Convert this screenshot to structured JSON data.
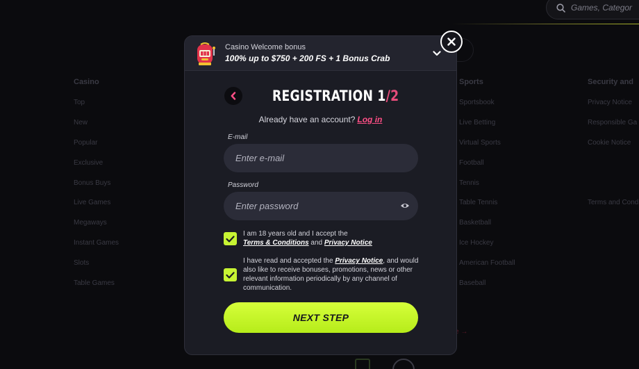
{
  "search": {
    "placeholder": "Games, Categor"
  },
  "footer": {
    "casino": {
      "title": "Casino",
      "items": [
        "Top",
        "New",
        "Popular",
        "Exclusive",
        "Bonus Buys",
        "Live Games",
        "Megaways",
        "Instant Games",
        "Slots",
        "Table Games"
      ]
    },
    "sports": {
      "title": "Sports",
      "items": [
        "Sportsbook",
        "Live Betting",
        "Virtual Sports",
        "Football",
        "Tennis",
        "Table Tennis",
        "Basketball",
        "Ice Hockey",
        "American Football",
        "Baseball"
      ]
    },
    "security": {
      "title": "Security and",
      "items": [
        "Privacy Notice",
        "Responsible Ga",
        "Cookie Notice"
      ],
      "extra": "Terms and Cond"
    },
    "more_arrow": "e →"
  },
  "bonus": {
    "title": "Casino Welcome bonus",
    "offer": "100% up to $750 + 200 FS + 1 Bonus Crab"
  },
  "registration": {
    "title": "REGISTRATION ",
    "step_current": "1",
    "step_total": "/2",
    "already_text": "Already have an account?",
    "login_link": "Log in",
    "email_label": "E-mail",
    "email_placeholder": "Enter e-mail",
    "password_label": "Password",
    "password_placeholder": "Enter password",
    "consent1_text": "I am 18 years old and I accept the",
    "consent1_link1": "Terms & Conditions",
    "consent1_and": "and",
    "consent1_link2": "Privacy Notice",
    "consent2_pre": "I have read and accepted the",
    "consent2_link": "Privacy Notice",
    "consent2_post": ", and would also like to receive bonuses, promotions, news or other relevant information periodically by any channel of communication.",
    "next_button": "NEXT STEP"
  },
  "colors": {
    "accent": "#c7f433",
    "pink": "#ff4f86",
    "modal_bg": "#1b1c24",
    "field_bg": "#2b2c38"
  },
  "icons": [
    "search-icon",
    "slot-machine-icon",
    "chevron-down-icon",
    "close-icon",
    "back-arrow-icon",
    "eye-icon",
    "checkmark-icon"
  ]
}
